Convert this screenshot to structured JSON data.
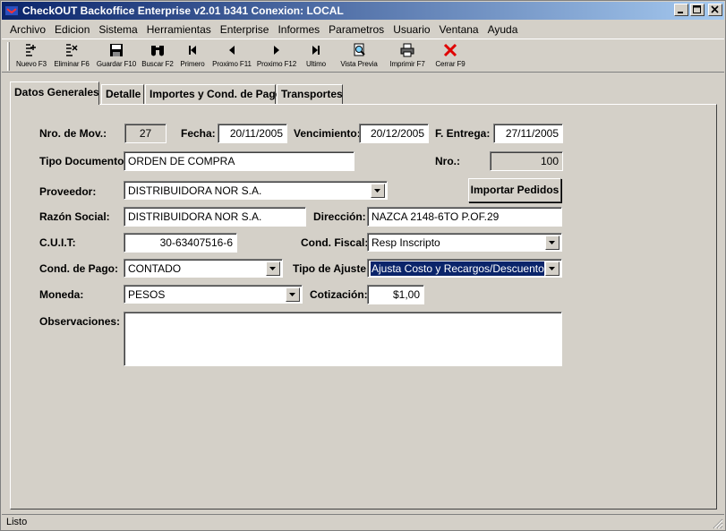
{
  "window": {
    "title": "CheckOUT Backoffice Enterprise v2.01 b341 Conexion: LOCAL",
    "controls": [
      "minimize",
      "maximize",
      "close"
    ]
  },
  "menu": [
    "Archivo",
    "Edicion",
    "Sistema",
    "Herramientas",
    "Enterprise",
    "Informes",
    "Parametros",
    "Usuario",
    "Ventana",
    "Ayuda"
  ],
  "toolbar": [
    {
      "label": "Nuevo F3",
      "icon": "new-icon"
    },
    {
      "label": "Eliminar F6",
      "icon": "delete-icon"
    },
    {
      "label": "Guardar F10",
      "icon": "save-icon"
    },
    {
      "label": "Buscar F2",
      "icon": "binoculars-icon"
    },
    {
      "label": "Primero",
      "icon": "first-icon"
    },
    {
      "label": "Proximo F11",
      "icon": "prev-icon"
    },
    {
      "label": "Proximo F12",
      "icon": "next-icon"
    },
    {
      "label": "Ultimo",
      "icon": "last-icon"
    },
    {
      "label": "Vista Previa",
      "icon": "preview-icon"
    },
    {
      "label": "Imprimir F7",
      "icon": "printer-icon"
    },
    {
      "label": "Cerrar F9",
      "icon": "close-red-icon"
    }
  ],
  "tabs": [
    "Datos Generales",
    "Detalle",
    "Importes y Cond. de Pago",
    "Transportes"
  ],
  "form": {
    "nro_mov_label": "Nro. de Mov.:",
    "nro_mov": "27",
    "fecha_label": "Fecha:",
    "fecha": "20/11/2005",
    "vencimiento_label": "Vencimiento:",
    "vencimiento": "20/12/2005",
    "f_entrega_label": "F. Entrega:",
    "f_entrega": "27/11/2005",
    "tipo_doc_label": "Tipo Documento:",
    "tipo_doc": "ORDEN DE COMPRA",
    "nro_label": "Nro.:",
    "nro": "100",
    "proveedor_label": "Proveedor:",
    "proveedor": "DISTRIBUIDORA NOR S.A.",
    "importar_label": "Importar Pedidos",
    "razon_label": "Razón Social:",
    "razon": "DISTRIBUIDORA NOR S.A.",
    "direccion_label": "Dirección:",
    "direccion": "NAZCA 2148-6TO P.OF.29",
    "cuit_label": "C.U.I.T:",
    "cuit": "30-63407516-6",
    "cond_fiscal_label": "Cond. Fiscal:",
    "cond_fiscal": "Resp Inscripto",
    "cond_pago_label": "Cond. de Pago:",
    "cond_pago": "CONTADO",
    "tipo_ajuste_label": "Tipo de Ajuste:",
    "tipo_ajuste": "Ajusta Costo y Recargos/Descuento",
    "moneda_label": "Moneda:",
    "moneda": "PESOS",
    "cotizacion_label": "Cotización:",
    "cotizacion": "$1,00",
    "observaciones_label": "Observaciones:",
    "observaciones": ""
  },
  "status": {
    "text": "Listo"
  }
}
